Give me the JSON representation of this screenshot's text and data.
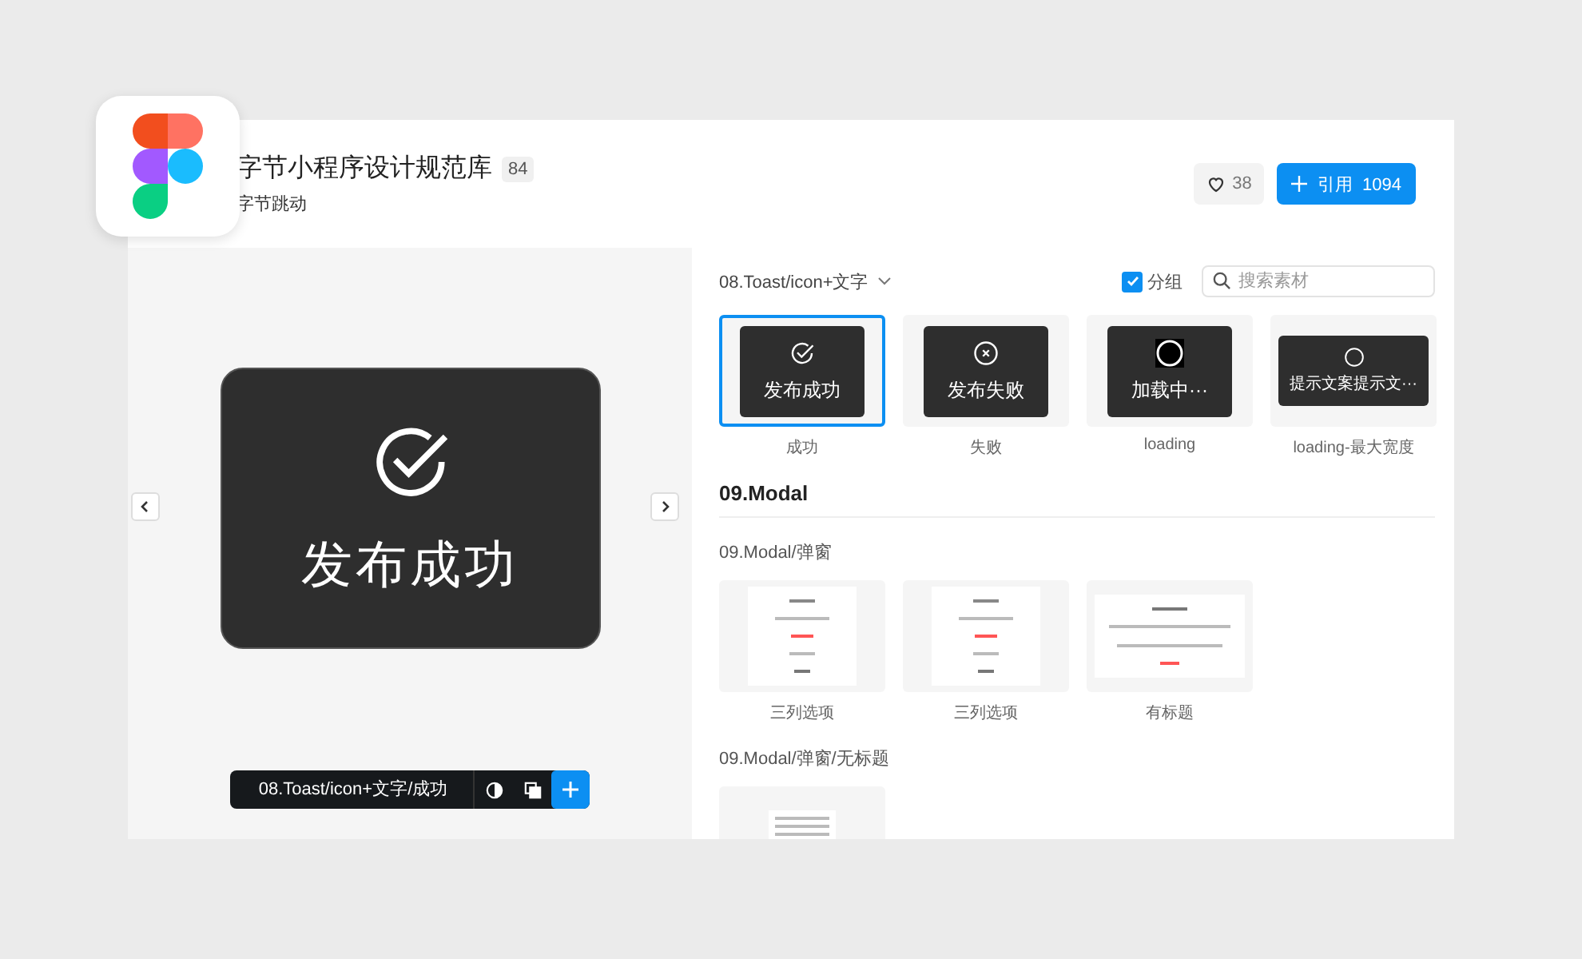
{
  "header": {
    "title": "字节小程序设计规范库",
    "count_badge": "84",
    "subtitle": "字节跳动",
    "likes": "38",
    "cite_button": {
      "label": "引用",
      "count": "1094"
    }
  },
  "preview": {
    "toast_text": "发布成功",
    "toolbar_path": "08.Toast/icon+文字/成功"
  },
  "toolbar": {
    "breadcrumb": "08.Toast/icon+文字",
    "group_toggle": {
      "label": "分组",
      "checked": true
    },
    "search": {
      "placeholder": "搜索素材"
    }
  },
  "toast_items": [
    {
      "kind": "success",
      "text": "发布成功",
      "caption": "成功",
      "selected": true
    },
    {
      "kind": "error",
      "text": "发布失败",
      "caption": "失败",
      "selected": false
    },
    {
      "kind": "loading",
      "text": "加载中···",
      "caption": "loading",
      "selected": false
    },
    {
      "kind": "wide",
      "text": "提示文案提示文···",
      "caption": "loading-最大宽度",
      "selected": false
    }
  ],
  "section": {
    "title": "09.Modal",
    "groups": [
      {
        "title": "09.Modal/弹窗",
        "items": [
          {
            "kind": "options",
            "caption": "三列选项"
          },
          {
            "kind": "options",
            "caption": "三列选项"
          },
          {
            "kind": "titled",
            "caption": "有标题"
          }
        ]
      },
      {
        "title": "09.Modal/弹窗/无标题",
        "items": [
          {
            "kind": "text"
          }
        ]
      }
    ]
  }
}
